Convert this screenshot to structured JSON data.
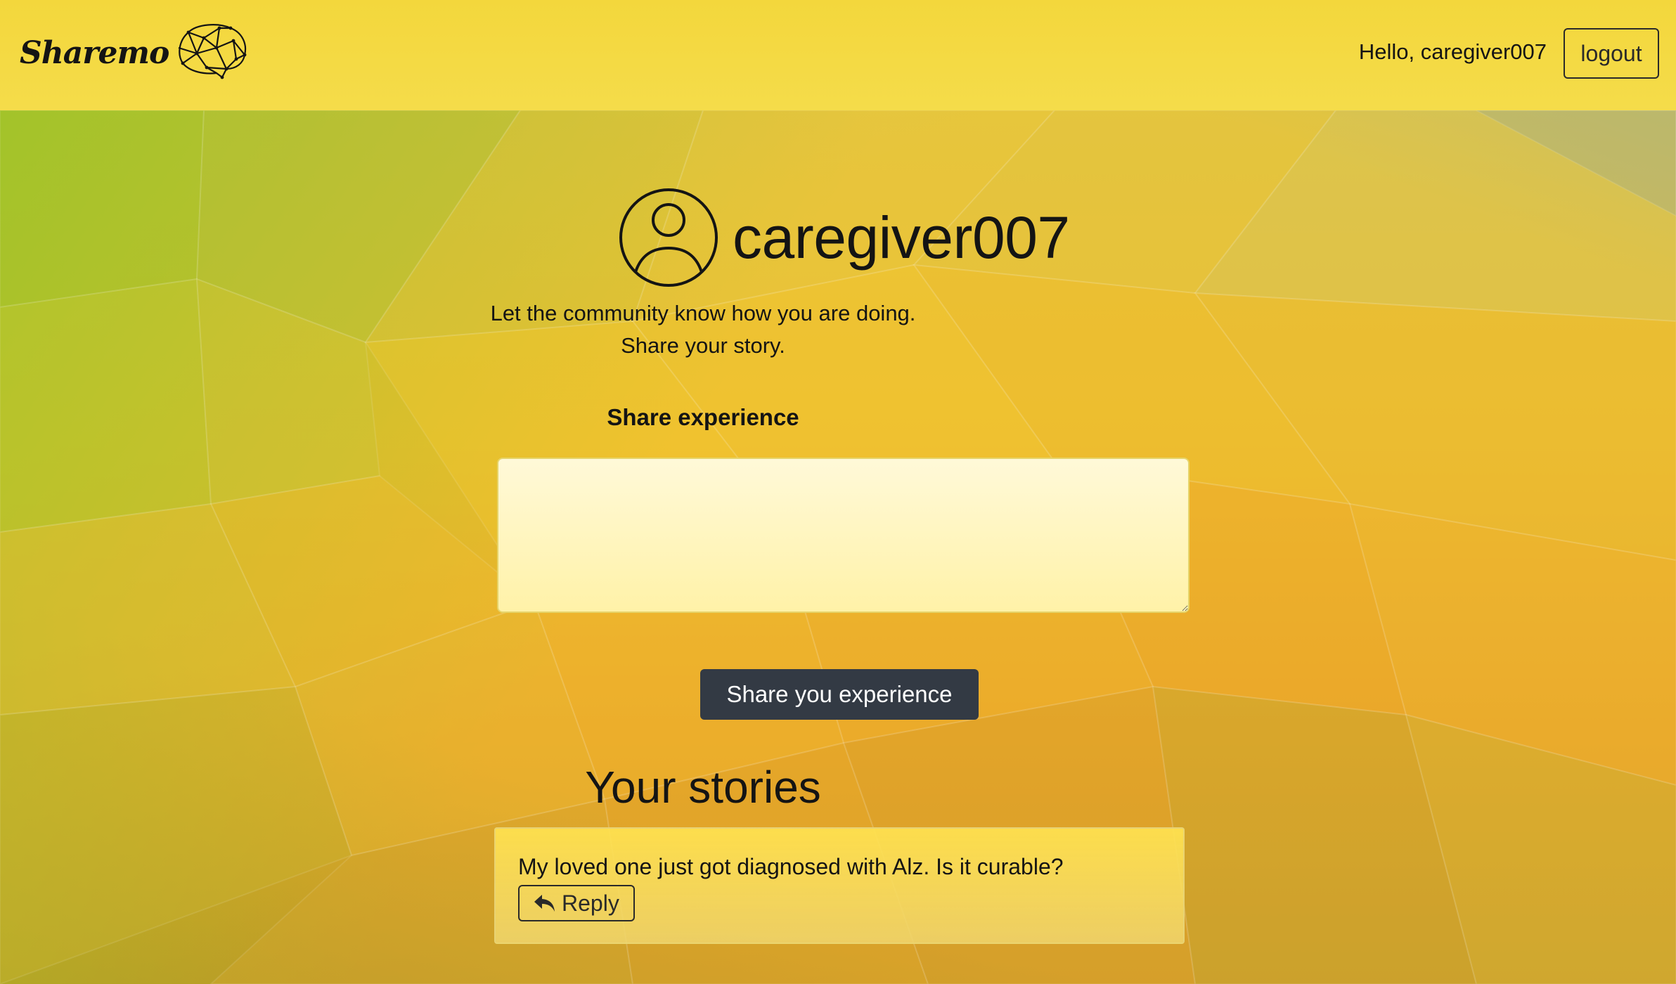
{
  "header": {
    "brand": "Sharemo",
    "greeting": "Hello, caregiver007",
    "logout_label": "logout"
  },
  "profile": {
    "username": "caregiver007",
    "intro_line1": "Let the community know how you are doing.",
    "intro_line2": "Share your story."
  },
  "share_form": {
    "label": "Share experience",
    "textarea_value": "",
    "submit_label": "Share you experience"
  },
  "stories": {
    "heading": "Your stories",
    "items": [
      {
        "text": "My loved one just got diagnosed with Alz. Is it curable?",
        "reply_label": "Reply"
      }
    ]
  },
  "colors": {
    "navbar": "#f3d73c",
    "button_dark": "#333a44",
    "textarea_bg": "#fff6c0"
  }
}
